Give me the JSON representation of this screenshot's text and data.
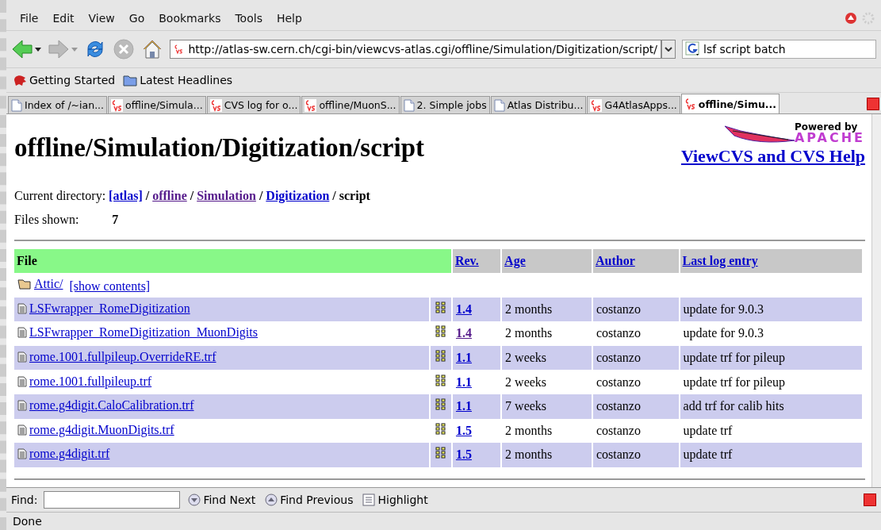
{
  "menu": [
    "File",
    "Edit",
    "View",
    "Go",
    "Bookmarks",
    "Tools",
    "Help"
  ],
  "toolbar": [
    {
      "kind": "back",
      "disabled": false
    },
    {
      "kind": "forward",
      "disabled": true
    },
    {
      "kind": "reload",
      "disabled": false
    },
    {
      "kind": "stop",
      "disabled": true
    },
    {
      "kind": "home",
      "disabled": false
    }
  ],
  "address": {
    "value": "http://atlas-sw.cern.ch/cgi-bin/viewcvs-atlas.cgi/offline/Simulation/Digitization/script/"
  },
  "search": {
    "value": "lsf script batch"
  },
  "bookmarks": [
    {
      "kind": "logo",
      "label": "Getting Started"
    },
    {
      "kind": "folder",
      "label": "Latest Headlines"
    }
  ],
  "tabs": [
    {
      "label": "Index of /~ian...",
      "kind": "page",
      "selected": false
    },
    {
      "label": "offline/Simula...",
      "kind": "cvs",
      "selected": false
    },
    {
      "label": "CVS log for o...",
      "kind": "cvs",
      "selected": false
    },
    {
      "label": "offline/MuonS...",
      "kind": "cvs",
      "selected": false
    },
    {
      "label": "2.  Simple jobs",
      "kind": "page",
      "selected": false
    },
    {
      "label": "Atlas Distribu...",
      "kind": "page",
      "selected": false
    },
    {
      "label": "G4AtlasApps...",
      "kind": "cvs",
      "selected": false
    },
    {
      "label": "offline/Simu...",
      "kind": "cvs",
      "selected": true
    }
  ],
  "page": {
    "title": "offline/Simulation/Digitization/script",
    "powered_by": "Powered by",
    "apache": "APACHE",
    "help_link": "ViewCVS and CVS Help",
    "current_directory_label": "Current directory:",
    "breadcrumbs": [
      {
        "label": "[atlas]",
        "visited": false
      },
      {
        "label": "offline",
        "visited": true
      },
      {
        "label": "Simulation",
        "visited": true
      },
      {
        "label": "Digitization",
        "visited": false
      }
    ],
    "separator": "/",
    "current": "script",
    "files_shown_label": "Files shown:",
    "files_shown": "7"
  },
  "table": {
    "columns": [
      "File",
      "Rev.",
      "Age",
      "Author",
      "Last log entry"
    ],
    "attic": {
      "label": "Attic/",
      "action": "[show contents]"
    },
    "rows": [
      {
        "file": "LSFwrapper_RomeDigitization",
        "rev": "1.4",
        "rev_visited": false,
        "age": "2 months",
        "author": "costanzo",
        "log": "update for 9.0.3"
      },
      {
        "file": "LSFwrapper_RomeDigitization_MuonDigits",
        "rev": "1.4",
        "rev_visited": true,
        "age": "2 months",
        "author": "costanzo",
        "log": "update for 9.0.3"
      },
      {
        "file": "rome.1001.fullpileup.OverrideRE.trf",
        "rev": "1.1",
        "rev_visited": false,
        "age": "2 weeks",
        "author": "costanzo",
        "log": "update trf for pileup"
      },
      {
        "file": "rome.1001.fullpileup.trf",
        "rev": "1.1",
        "rev_visited": false,
        "age": "2 weeks",
        "author": "costanzo",
        "log": "update trf for pileup"
      },
      {
        "file": "rome.g4digit.CaloCalibration.trf",
        "rev": "1.1",
        "rev_visited": false,
        "age": "7 weeks",
        "author": "costanzo",
        "log": "add trf for calib hits"
      },
      {
        "file": "rome.g4digit.MuonDigits.trf",
        "rev": "1.5",
        "rev_visited": false,
        "age": "2 months",
        "author": "costanzo",
        "log": "update trf"
      },
      {
        "file": "rome.g4digit.trf",
        "rev": "1.5",
        "rev_visited": false,
        "age": "2 months",
        "author": "costanzo",
        "log": "update trf"
      }
    ]
  },
  "find_bar": {
    "label": "Find:",
    "buttons": [
      {
        "kind": "next",
        "label": "Find Next"
      },
      {
        "kind": "previous",
        "label": "Find Previous"
      },
      {
        "kind": "highlight",
        "label": "Highlight"
      }
    ]
  },
  "status_bar": "Done"
}
